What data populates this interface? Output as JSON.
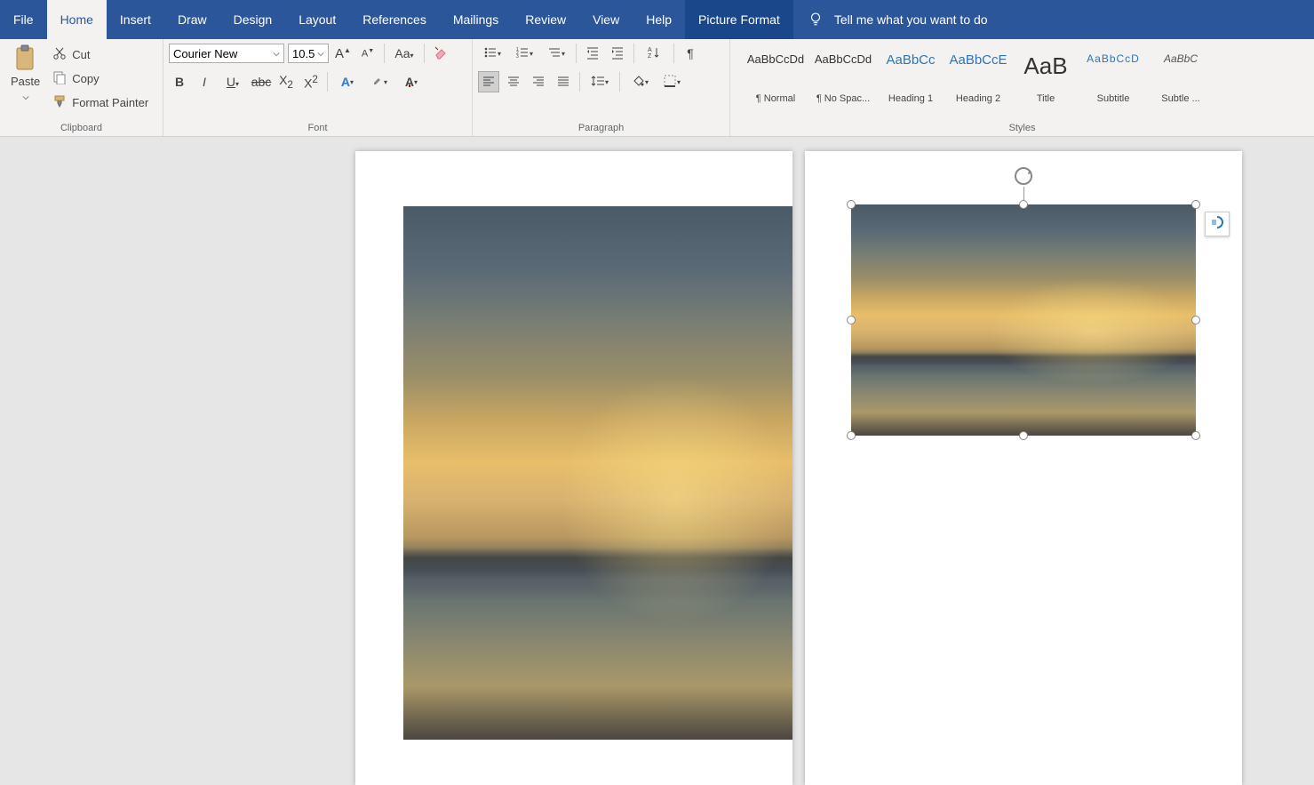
{
  "tabs": {
    "file": "File",
    "home": "Home",
    "insert": "Insert",
    "draw": "Draw",
    "design": "Design",
    "layout": "Layout",
    "references": "References",
    "mailings": "Mailings",
    "review": "Review",
    "view": "View",
    "help": "Help",
    "picture_format": "Picture Format"
  },
  "tellme": {
    "placeholder": "Tell me what you want to do"
  },
  "clipboard": {
    "paste": "Paste",
    "cut": "Cut",
    "copy": "Copy",
    "format_painter": "Format Painter",
    "group_label": "Clipboard"
  },
  "font": {
    "name": "Courier New",
    "size": "10.5",
    "group_label": "Font"
  },
  "paragraph": {
    "group_label": "Paragraph"
  },
  "styles": {
    "group_label": "Styles",
    "items": [
      {
        "preview": "AaBbCcDd",
        "name": "¶ Normal",
        "cls": ""
      },
      {
        "preview": "AaBbCcDd",
        "name": "¶ No Spac...",
        "cls": ""
      },
      {
        "preview": "AaBbCc",
        "name": "Heading 1",
        "cls": "heading"
      },
      {
        "preview": "AaBbCcE",
        "name": "Heading 2",
        "cls": "heading"
      },
      {
        "preview": "AaB",
        "name": "Title",
        "cls": "title"
      },
      {
        "preview": "AaBbCcD",
        "name": "Subtitle",
        "cls": "subtle"
      },
      {
        "preview": "AaBbC",
        "name": "Subtle ...",
        "cls": "emph"
      }
    ]
  },
  "colors": {
    "highlight": "#ffff00",
    "font_color": "#c00000"
  }
}
